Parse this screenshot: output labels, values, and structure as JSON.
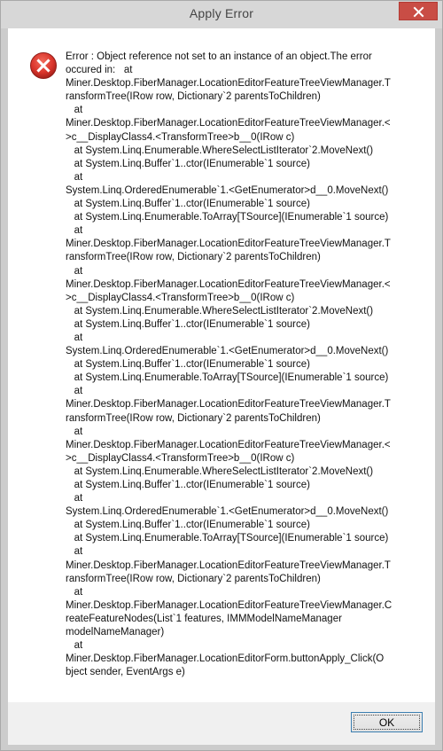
{
  "window": {
    "title": "Apply Error"
  },
  "dialog": {
    "message": "Error : Object reference not set to an instance of an object.The error\noccured in:   at\nMiner.Desktop.FiberManager.LocationEditorFeatureTreeViewManager.T\nransformTree(IRow row, Dictionary`2 parentsToChildren)\n   at\nMiner.Desktop.FiberManager.LocationEditorFeatureTreeViewManager.<\n>c__DisplayClass4.<TransformTree>b__0(IRow c)\n   at System.Linq.Enumerable.WhereSelectListIterator`2.MoveNext()\n   at System.Linq.Buffer`1..ctor(IEnumerable`1 source)\n   at\nSystem.Linq.OrderedEnumerable`1.<GetEnumerator>d__0.MoveNext()\n   at System.Linq.Buffer`1..ctor(IEnumerable`1 source)\n   at System.Linq.Enumerable.ToArray[TSource](IEnumerable`1 source)\n   at\nMiner.Desktop.FiberManager.LocationEditorFeatureTreeViewManager.T\nransformTree(IRow row, Dictionary`2 parentsToChildren)\n   at\nMiner.Desktop.FiberManager.LocationEditorFeatureTreeViewManager.<\n>c__DisplayClass4.<TransformTree>b__0(IRow c)\n   at System.Linq.Enumerable.WhereSelectListIterator`2.MoveNext()\n   at System.Linq.Buffer`1..ctor(IEnumerable`1 source)\n   at\nSystem.Linq.OrderedEnumerable`1.<GetEnumerator>d__0.MoveNext()\n   at System.Linq.Buffer`1..ctor(IEnumerable`1 source)\n   at System.Linq.Enumerable.ToArray[TSource](IEnumerable`1 source)\n   at\nMiner.Desktop.FiberManager.LocationEditorFeatureTreeViewManager.T\nransformTree(IRow row, Dictionary`2 parentsToChildren)\n   at\nMiner.Desktop.FiberManager.LocationEditorFeatureTreeViewManager.<\n>c__DisplayClass4.<TransformTree>b__0(IRow c)\n   at System.Linq.Enumerable.WhereSelectListIterator`2.MoveNext()\n   at System.Linq.Buffer`1..ctor(IEnumerable`1 source)\n   at\nSystem.Linq.OrderedEnumerable`1.<GetEnumerator>d__0.MoveNext()\n   at System.Linq.Buffer`1..ctor(IEnumerable`1 source)\n   at System.Linq.Enumerable.ToArray[TSource](IEnumerable`1 source)\n   at\nMiner.Desktop.FiberManager.LocationEditorFeatureTreeViewManager.T\nransformTree(IRow row, Dictionary`2 parentsToChildren)\n   at\nMiner.Desktop.FiberManager.LocationEditorFeatureTreeViewManager.C\nreateFeatureNodes(List`1 features, IMMModelNameManager\nmodelNameManager)\n   at\nMiner.Desktop.FiberManager.LocationEditorForm.buttonApply_Click(O\nbject sender, EventArgs e)"
  },
  "buttons": {
    "ok_label": "OK"
  },
  "icons": {
    "close": "close-icon",
    "error": "error-icon"
  },
  "colors": {
    "close_button": "#c94d45",
    "error_icon": "#d9342b",
    "ok_border": "#3c7fb1"
  }
}
